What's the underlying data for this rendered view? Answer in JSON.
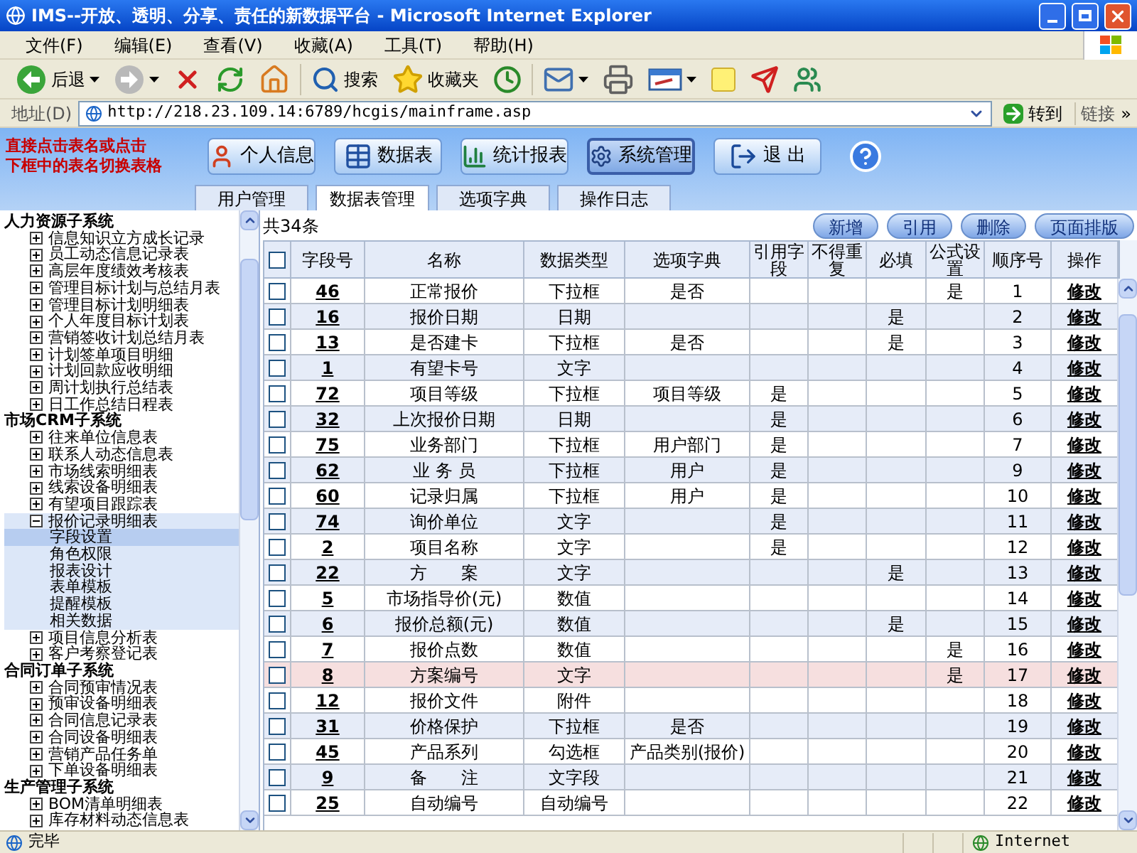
{
  "window": {
    "title": "IMS--开放、透明、分享、责任的新数据平台 - Microsoft Internet Explorer"
  },
  "menu": [
    "文件(F)",
    "编辑(E)",
    "查看(V)",
    "收藏(A)",
    "工具(T)",
    "帮助(H)"
  ],
  "toolbar": [
    {
      "kind": "back",
      "label": "后退"
    },
    {
      "kind": "forward"
    },
    {
      "kind": "stop"
    },
    {
      "kind": "refresh"
    },
    {
      "kind": "home"
    },
    {
      "kind": "search",
      "label": "搜索"
    },
    {
      "kind": "favorites",
      "label": "收藏夹"
    },
    {
      "kind": "history"
    },
    {
      "kind": "mail"
    },
    {
      "kind": "print"
    },
    {
      "kind": "edit"
    },
    {
      "kind": "note"
    },
    {
      "kind": "messenger"
    },
    {
      "kind": "contacts"
    }
  ],
  "address": {
    "label": "地址(D)",
    "url": "http://218.23.109.14:6789/hcgis/mainframe.asp",
    "go": "转到",
    "links": "链接",
    "more": "»"
  },
  "hint": [
    "直接点击表名或点击",
    "下框中的表名切换表格"
  ],
  "nav_buttons": [
    {
      "kind": "profile",
      "label": "个人信息",
      "selected": false
    },
    {
      "kind": "table",
      "label": "数据表",
      "selected": false
    },
    {
      "kind": "report",
      "label": "统计报表",
      "selected": false
    },
    {
      "kind": "settings",
      "label": "系统管理",
      "selected": true
    },
    {
      "kind": "exit",
      "label": "退 出",
      "selected": false
    }
  ],
  "tabs": [
    {
      "label": "用户管理",
      "selected": false
    },
    {
      "label": "数据表管理",
      "selected": true
    },
    {
      "label": "选项字典",
      "selected": false
    },
    {
      "label": "操作日志",
      "selected": false
    }
  ],
  "tree": [
    {
      "label": "人力资源子系统",
      "children": [
        {
          "label": "信息知识立方成长记录",
          "expanded": false
        },
        {
          "label": "员工动态信息记录表",
          "expanded": false
        },
        {
          "label": "高层年度绩效考核表",
          "expanded": false
        },
        {
          "label": "管理目标计划与总结月表",
          "expanded": false
        },
        {
          "label": "管理目标计划明细表",
          "expanded": false
        },
        {
          "label": "个人年度目标计划表",
          "expanded": false
        },
        {
          "label": "营销签收计划总结月表",
          "expanded": false
        },
        {
          "label": "计划签单项目明细",
          "expanded": false
        },
        {
          "label": "计划回款应收明细",
          "expanded": false
        },
        {
          "label": "周计划执行总结表",
          "expanded": false
        },
        {
          "label": "日工作总结日程表",
          "expanded": false
        }
      ]
    },
    {
      "label": "市场CRM子系统",
      "children": [
        {
          "label": "往来单位信息表",
          "expanded": false
        },
        {
          "label": "联系人动态信息表",
          "expanded": false
        },
        {
          "label": "市场线索明细表",
          "expanded": false
        },
        {
          "label": "线索设备明细表",
          "expanded": false
        },
        {
          "label": "有望项目跟踪表",
          "expanded": false
        },
        {
          "label": "报价记录明细表",
          "expanded": true,
          "children": [
            {
              "label": "字段设置",
              "selected": true
            },
            {
              "label": "角色权限",
              "selected": false
            },
            {
              "label": "报表设计",
              "selected": false
            },
            {
              "label": "表单模板",
              "selected": false
            },
            {
              "label": "提醒模板",
              "selected": false
            },
            {
              "label": "相关数据",
              "selected": false
            }
          ]
        },
        {
          "label": "项目信息分析表",
          "expanded": false
        },
        {
          "label": "客户考察登记表",
          "expanded": false
        }
      ]
    },
    {
      "label": "合同订单子系统",
      "children": [
        {
          "label": "合同预审情况表",
          "expanded": false
        },
        {
          "label": "预审设备明细表",
          "expanded": false
        },
        {
          "label": "合同信息记录表",
          "expanded": false
        },
        {
          "label": "合同设备明细表",
          "expanded": false
        },
        {
          "label": "营销产品任务单",
          "expanded": false
        },
        {
          "label": "下单设备明细表",
          "expanded": false
        }
      ]
    },
    {
      "label": "生产管理子系统",
      "children": [
        {
          "label": "BOM清单明细表",
          "expanded": false
        },
        {
          "label": "库存材料动态信息表",
          "expanded": false
        }
      ]
    }
  ],
  "record_count": "共34条",
  "actions": [
    "新增",
    "引用",
    "删除",
    "页面排版"
  ],
  "table": {
    "select_all_checked": false,
    "columns": [
      "字段号",
      "名称",
      "数据类型",
      "选项字典",
      "引用字段",
      "不得重复",
      "必填",
      "公式设置",
      "顺序号",
      "操作"
    ],
    "rows": [
      {
        "field_no": "46",
        "name": "正常报价",
        "data_type": "下拉框",
        "option_dict": "是否",
        "formula": "是",
        "order": "1",
        "action": "修改",
        "checked": false,
        "selected": false
      },
      {
        "field_no": "16",
        "name": "报价日期",
        "data_type": "日期",
        "required": "是",
        "order": "2",
        "action": "修改",
        "checked": false,
        "selected": false
      },
      {
        "field_no": "13",
        "name": "是否建卡",
        "data_type": "下拉框",
        "option_dict": "是否",
        "required": "是",
        "order": "3",
        "action": "修改",
        "checked": false,
        "selected": false
      },
      {
        "field_no": "1",
        "name": "有望卡号",
        "data_type": "文字",
        "order": "4",
        "action": "修改",
        "checked": false,
        "selected": false
      },
      {
        "field_no": "72",
        "name": "项目等级",
        "data_type": "下拉框",
        "option_dict": "项目等级",
        "ref_field": "是",
        "order": "5",
        "action": "修改",
        "checked": false,
        "selected": false
      },
      {
        "field_no": "32",
        "name": "上次报价日期",
        "data_type": "日期",
        "ref_field": "是",
        "order": "6",
        "action": "修改",
        "checked": false,
        "selected": false
      },
      {
        "field_no": "75",
        "name": "业务部门",
        "data_type": "下拉框",
        "option_dict": "用户部门",
        "ref_field": "是",
        "order": "7",
        "action": "修改",
        "checked": false,
        "selected": false
      },
      {
        "field_no": "62",
        "name": "业 务 员",
        "data_type": "下拉框",
        "option_dict": "用户",
        "ref_field": "是",
        "order": "9",
        "action": "修改",
        "checked": false,
        "selected": false
      },
      {
        "field_no": "60",
        "name": "记录归属",
        "data_type": "下拉框",
        "option_dict": "用户",
        "ref_field": "是",
        "order": "10",
        "action": "修改",
        "checked": false,
        "selected": false
      },
      {
        "field_no": "74",
        "name": "询价单位",
        "data_type": "文字",
        "ref_field": "是",
        "order": "11",
        "action": "修改",
        "checked": false,
        "selected": false
      },
      {
        "field_no": "2",
        "name": "项目名称",
        "data_type": "文字",
        "ref_field": "是",
        "order": "12",
        "action": "修改",
        "checked": false,
        "selected": false
      },
      {
        "field_no": "22",
        "name": "方　　案",
        "data_type": "文字",
        "required": "是",
        "order": "13",
        "action": "修改",
        "checked": false,
        "selected": false
      },
      {
        "field_no": "5",
        "name": "市场指导价(元)",
        "data_type": "数值",
        "order": "14",
        "action": "修改",
        "checked": false,
        "selected": false
      },
      {
        "field_no": "6",
        "name": "报价总额(元)",
        "data_type": "数值",
        "required": "是",
        "order": "15",
        "action": "修改",
        "checked": false,
        "selected": false
      },
      {
        "field_no": "7",
        "name": "报价点数",
        "data_type": "数值",
        "formula": "是",
        "order": "16",
        "action": "修改",
        "checked": false,
        "selected": false
      },
      {
        "field_no": "8",
        "name": "方案编号",
        "data_type": "文字",
        "formula": "是",
        "order": "17",
        "action": "修改",
        "checked": false,
        "selected": true
      },
      {
        "field_no": "12",
        "name": "报价文件",
        "data_type": "附件",
        "order": "18",
        "action": "修改",
        "checked": false,
        "selected": false
      },
      {
        "field_no": "31",
        "name": "价格保护",
        "data_type": "下拉框",
        "option_dict": "是否",
        "order": "19",
        "action": "修改",
        "checked": false,
        "selected": false
      },
      {
        "field_no": "45",
        "name": "产品系列",
        "data_type": "勾选框",
        "option_dict": "产品类别(报价)",
        "order": "20",
        "action": "修改",
        "checked": false,
        "selected": false
      },
      {
        "field_no": "9",
        "name": "备　　注",
        "data_type": "文字段",
        "order": "21",
        "action": "修改",
        "checked": false,
        "selected": false
      },
      {
        "field_no": "25",
        "name": "自动编号",
        "data_type": "自动编号",
        "order": "22",
        "action": "修改",
        "checked": false,
        "selected": false
      }
    ]
  },
  "status_bar": {
    "text": "完毕",
    "zone": "Internet"
  }
}
